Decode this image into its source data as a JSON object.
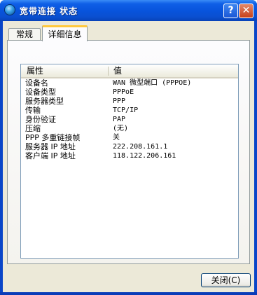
{
  "window": {
    "title": "宽带连接 状态",
    "icon": "network-globe-icon",
    "help_label": "?",
    "close_label": "✕"
  },
  "tabs": [
    {
      "label": "常规",
      "selected": false
    },
    {
      "label": "详细信息",
      "selected": true
    }
  ],
  "details": {
    "columns": {
      "property": "属性",
      "value": "值"
    },
    "rows": [
      {
        "property": "设备名",
        "value": "WAN 微型端口 (PPPOE)"
      },
      {
        "property": "设备类型",
        "value": "PPPoE"
      },
      {
        "property": "服务器类型",
        "value": "PPP"
      },
      {
        "property": "传输",
        "value": "TCP/IP"
      },
      {
        "property": "身份验证",
        "value": "PAP"
      },
      {
        "property": "压缩",
        "value": "(无)"
      },
      {
        "property": "PPP 多重链接帧",
        "value": "关"
      },
      {
        "property": "服务器 IP 地址",
        "value": "222.208.161.1"
      },
      {
        "property": "客户端 IP 地址",
        "value": "118.122.206.161"
      }
    ]
  },
  "buttons": {
    "close": "关闭(C)"
  }
}
